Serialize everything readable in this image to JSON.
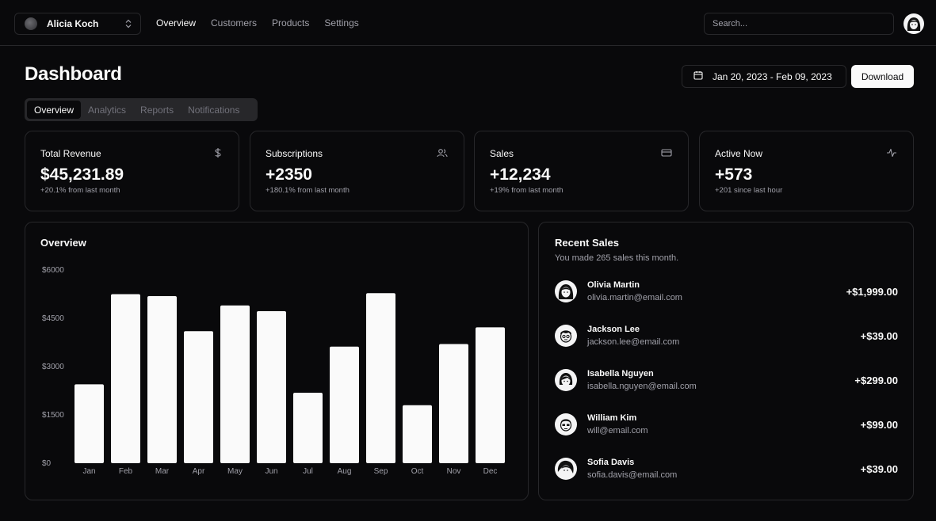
{
  "topbar": {
    "team_name": "Alicia Koch",
    "nav": [
      "Overview",
      "Customers",
      "Products",
      "Settings"
    ],
    "search_placeholder": "Search..."
  },
  "header": {
    "title": "Dashboard",
    "date_range": "Jan 20, 2023 - Feb 09, 2023",
    "download_label": "Download"
  },
  "tabs": [
    "Overview",
    "Analytics",
    "Reports",
    "Notifications"
  ],
  "stats": [
    {
      "title": "Total Revenue",
      "value": "$45,231.89",
      "sub": "+20.1% from last month",
      "icon": "dollar-icon"
    },
    {
      "title": "Subscriptions",
      "value": "+2350",
      "sub": "+180.1% from last month",
      "icon": "users-icon"
    },
    {
      "title": "Sales",
      "value": "+12,234",
      "sub": "+19% from last month",
      "icon": "credit-card-icon"
    },
    {
      "title": "Active Now",
      "value": "+573",
      "sub": "+201 since last hour",
      "icon": "activity-icon"
    }
  ],
  "overview": {
    "title": "Overview"
  },
  "chart_data": {
    "type": "bar",
    "categories": [
      "Jan",
      "Feb",
      "Mar",
      "Apr",
      "May",
      "Jun",
      "Jul",
      "Aug",
      "Sep",
      "Oct",
      "Nov",
      "Dec"
    ],
    "values": [
      2450,
      5250,
      5190,
      4100,
      4900,
      4720,
      2190,
      3620,
      5280,
      1800,
      3700,
      4220
    ],
    "yticks": [
      "$6000",
      "$4500",
      "$3000",
      "$1500",
      "$0"
    ],
    "ylim": [
      0,
      6000
    ],
    "bar_color": "#fafafa"
  },
  "recent_sales": {
    "title": "Recent Sales",
    "subtitle": "You made 265 sales this month.",
    "items": [
      {
        "name": "Olivia Martin",
        "email": "olivia.martin@email.com",
        "amount": "+$1,999.00"
      },
      {
        "name": "Jackson Lee",
        "email": "jackson.lee@email.com",
        "amount": "+$39.00"
      },
      {
        "name": "Isabella Nguyen",
        "email": "isabella.nguyen@email.com",
        "amount": "+$299.00"
      },
      {
        "name": "William Kim",
        "email": "will@email.com",
        "amount": "+$99.00"
      },
      {
        "name": "Sofia Davis",
        "email": "sofia.davis@email.com",
        "amount": "+$39.00"
      }
    ]
  },
  "colors": {
    "background": "#09090b",
    "border": "#27272a",
    "muted_text": "#a1a1aa",
    "foreground": "#fafafa"
  }
}
